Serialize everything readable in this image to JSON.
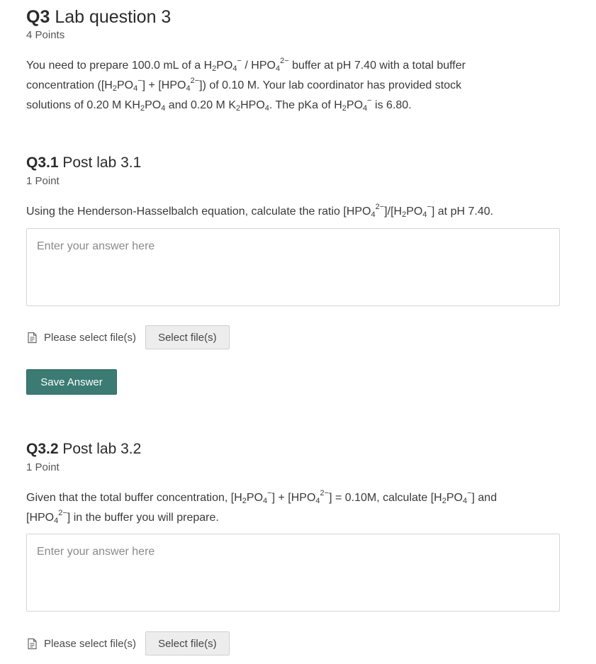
{
  "q3": {
    "number": "Q3",
    "title": "Lab question 3",
    "points": "4 Points",
    "prompt": {
      "line1_a": "You need to prepare 100.0 mL of a ",
      "line1_b": " buffer at pH 7.40 with a total buffer",
      "line2_a": "concentration ([",
      "line2_b": "] + [",
      "line2_c": "]) of 0.10 M. Your lab coordinator has provided stock",
      "line3_a": "solutions of 0.20 M ",
      "line3_b": " and 0.20 M ",
      "line3_c": ". The pKa of ",
      "line3_d": " is 6.80."
    }
  },
  "chem": {
    "h": "H",
    "po": "PO",
    "hpo": "HPO",
    "kh": "KH",
    "k": "K",
    "two": "2",
    "four": "4",
    "minus": "−",
    "two_minus": "2−",
    "slash": " / "
  },
  "q3_1": {
    "number": "Q3.1",
    "title": "Post lab 3.1",
    "points": "1 Point",
    "prompt": {
      "a": "Using the Henderson-Hasselbalch equation, calculate the ratio [",
      "b": "]/[",
      "c": "] at pH 7.40."
    },
    "answer_placeholder": "Enter your answer here",
    "file_label": "Please select file(s)",
    "file_button": "Select file(s)",
    "save_button": "Save Answer"
  },
  "q3_2": {
    "number": "Q3.2",
    "title": "Post lab 3.2",
    "points": "1 Point",
    "prompt": {
      "line1_a": "Given that the total buffer concentration, [",
      "line1_b": "] + [",
      "line1_c": "] = 0.10M, calculate [",
      "line1_d": "] and",
      "line2_a": "[",
      "line2_b": "] in the buffer you will prepare."
    },
    "answer_placeholder": "Enter your answer here",
    "file_label": "Please select file(s)",
    "file_button": "Select file(s)"
  },
  "colors": {
    "save_button_bg": "#3b7b73",
    "save_button_text": "#ffffff",
    "select_button_bg": "#ededed",
    "text": "#3a3a3a"
  },
  "icons": {
    "file_icon": "file-document-icon"
  }
}
